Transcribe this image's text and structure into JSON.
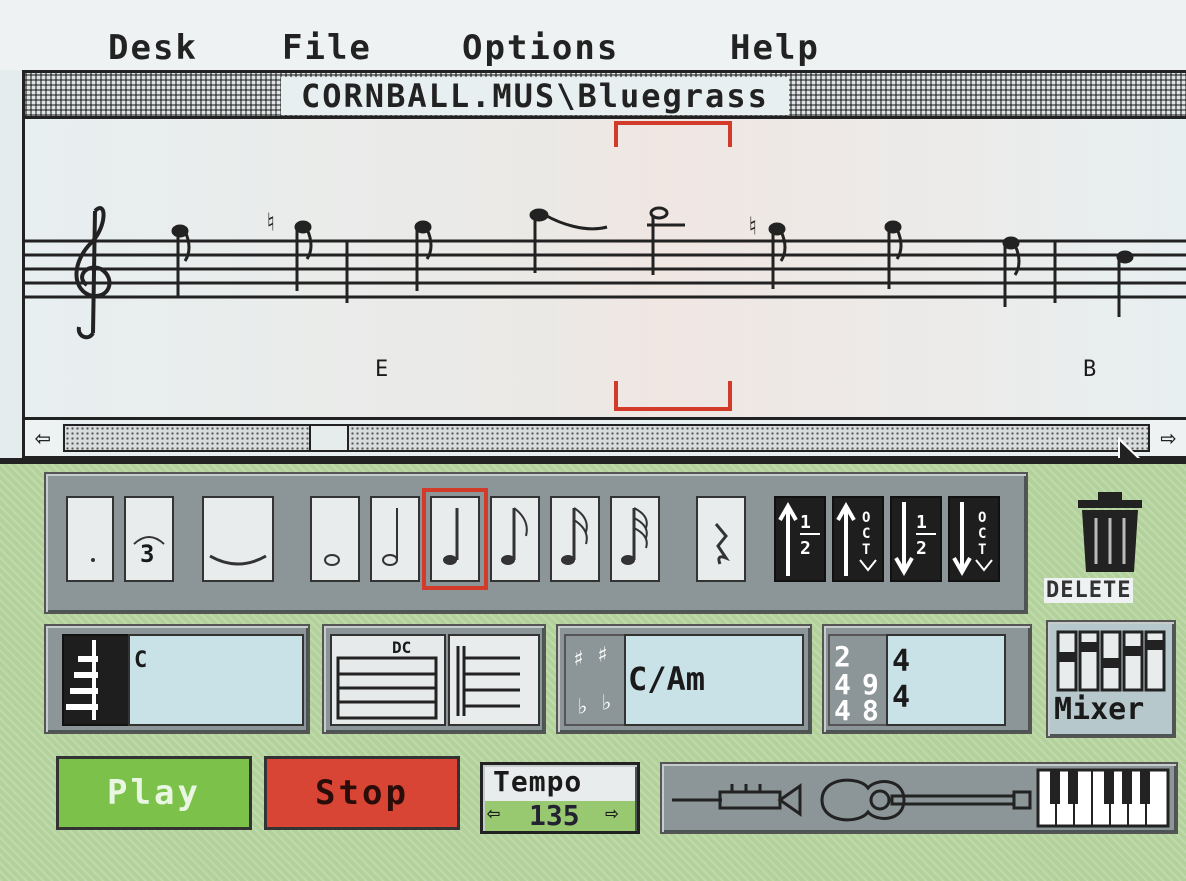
{
  "menu": {
    "items": [
      "Desk",
      "File",
      "Options",
      "Help"
    ]
  },
  "window": {
    "title": "CORNBALL.MUS\\Bluegrass"
  },
  "score": {
    "chords": [
      "E",
      "B"
    ]
  },
  "palette": {
    "triplet_label": "3",
    "transpose": {
      "up_half": "1/2",
      "up_oct": "OCT",
      "down_half": "1/2",
      "down_oct": "OCT"
    }
  },
  "delete_label": "DELETE",
  "controls": {
    "instrument_note": "C",
    "repeat_label": "DC",
    "key_signature": "C/Am",
    "time_options": [
      "2",
      "4",
      "9",
      "4",
      "8"
    ],
    "time_signature": {
      "top": "4",
      "bottom": "4"
    },
    "mixer_label": "Mixer"
  },
  "transport": {
    "play": "Play",
    "stop": "Stop",
    "tempo_label": "Tempo",
    "tempo_value": "135"
  },
  "colors": {
    "play": "#7cc24a",
    "stop": "#d94535",
    "selection": "#d23a2a",
    "panel_green": "#b3d29b",
    "tray_gray": "#8c9698",
    "info_blue": "#c9e2e8"
  }
}
